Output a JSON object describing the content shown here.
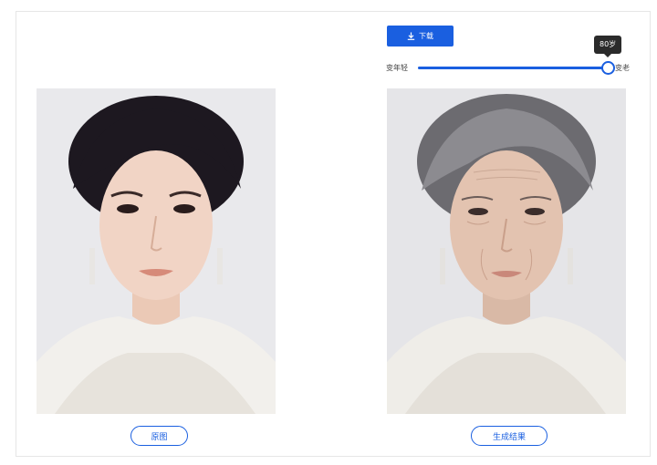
{
  "toolbar": {
    "download_label": "下载",
    "download_icon": "download-icon"
  },
  "age_slider": {
    "younger_label": "变年轻",
    "older_label": "变老",
    "tooltip": "80岁",
    "value_fraction": 1.0,
    "accent_color": "#1a5fe0"
  },
  "captions": {
    "original_label": "原图",
    "result_label": "生成结果"
  },
  "images": {
    "original": "portrait photo of young woman",
    "result": "age-transformed portrait of the same woman"
  }
}
